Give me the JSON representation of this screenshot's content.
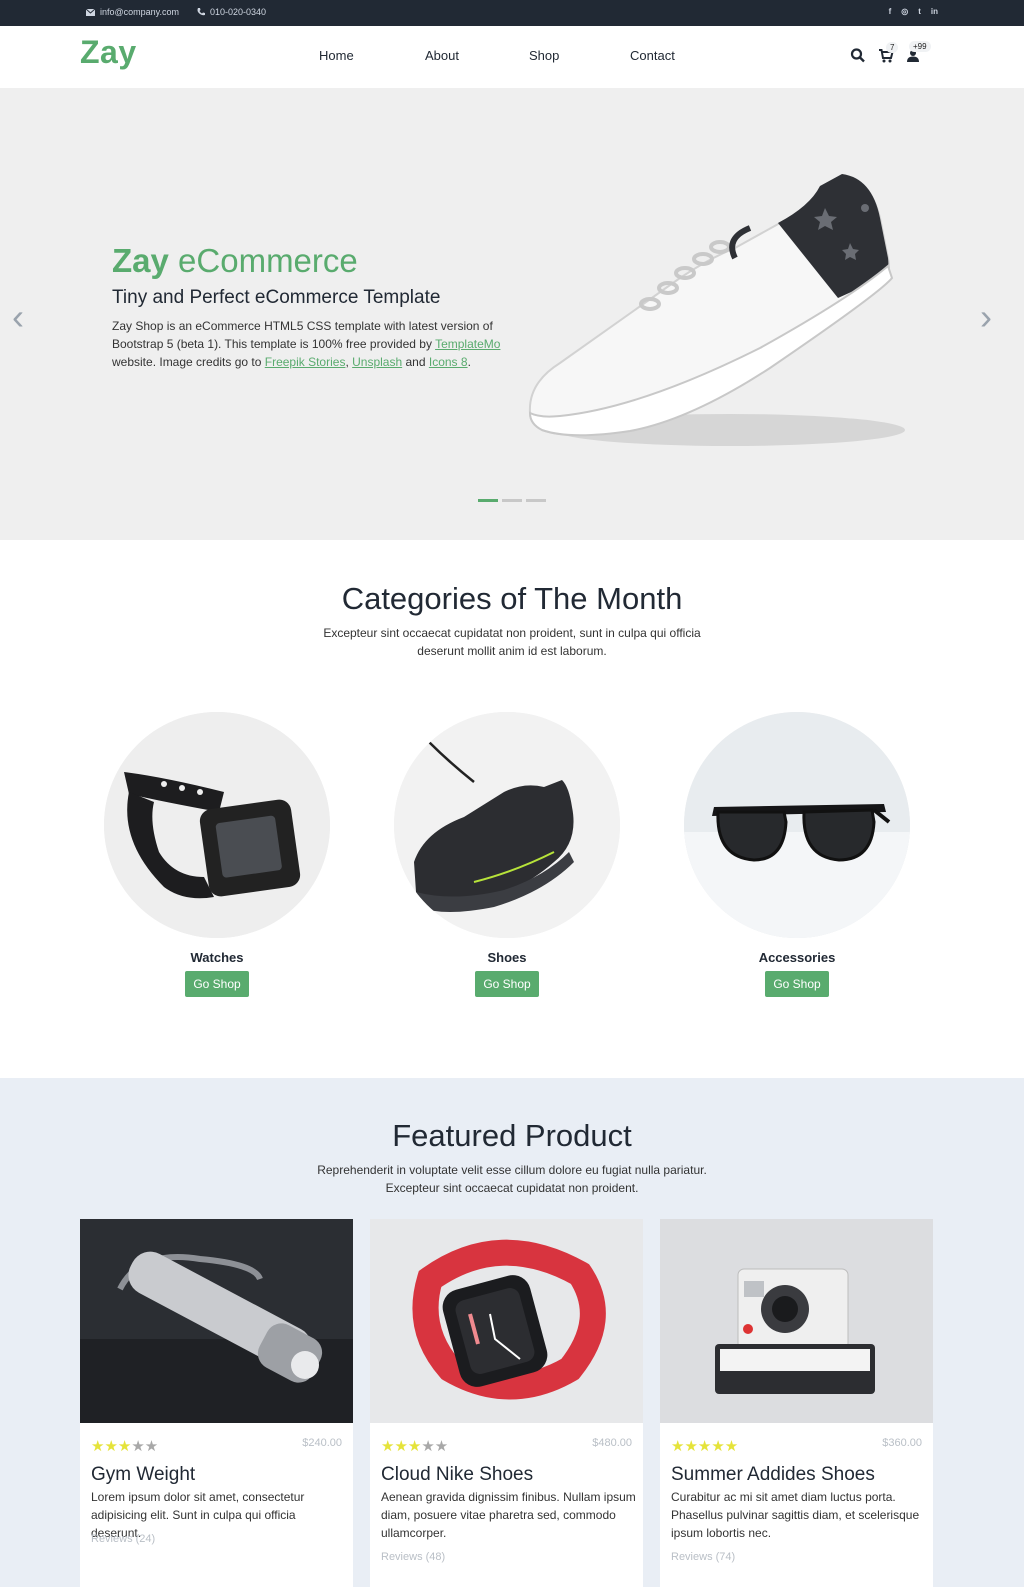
{
  "topbar": {
    "email": "info@company.com",
    "phone": "010-020-0340",
    "social": [
      "f",
      "◎",
      "t",
      "in"
    ]
  },
  "nav": {
    "logo": "Zay",
    "links": [
      "Home",
      "About",
      "Shop",
      "Contact"
    ],
    "cart_count": "7",
    "user_count": "+99"
  },
  "hero": {
    "title_strong": "Zay",
    "title_rest": " eCommerce",
    "subtitle": "Tiny and Perfect eCommerce Template",
    "desc_1": "Zay Shop is an eCommerce HTML5 CSS template with latest version of Bootstrap 5 (beta 1). This template is 100% free provided by ",
    "link_templatemo": "TemplateMo",
    "desc_2": " website. Image credits go to ",
    "link_freepik": "Freepik Stories",
    "desc_3": ", ",
    "link_unsplash": "Unsplash",
    "desc_4": " and ",
    "link_icons8": "Icons 8",
    "desc_5": ".",
    "prev_arrow": "‹",
    "next_arrow": "›",
    "active_slide": 1,
    "slide_count": 3
  },
  "categories": {
    "title": "Categories of The Month",
    "desc": "Excepteur sint occaecat cupidatat non proident, sunt in culpa qui officia deserunt mollit anim id est laborum.",
    "items": [
      {
        "name": "Watches",
        "button": "Go Shop"
      },
      {
        "name": "Shoes",
        "button": "Go Shop"
      },
      {
        "name": "Accessories",
        "button": "Go Shop"
      }
    ]
  },
  "featured": {
    "title": "Featured Product",
    "desc_1": "Reprehenderit in voluptate velit esse cillum dolore eu fugiat nulla pariatur.",
    "desc_2": "Excepteur sint occaecat cupidatat non proident.",
    "products": [
      {
        "stars": 3,
        "price": "$240.00",
        "title": "Gym Weight",
        "desc": "Lorem ipsum dolor sit amet, consectetur adipisicing elit. Sunt in culpa qui officia deserunt.",
        "reviews": "Reviews (24)"
      },
      {
        "stars": 3,
        "price": "$480.00",
        "title": "Cloud Nike Shoes",
        "desc": "Aenean gravida dignissim finibus. Nullam ipsum diam, posuere vitae pharetra sed, commodo ullamcorper.",
        "reviews": "Reviews (48)"
      },
      {
        "stars": 5,
        "price": "$360.00",
        "title": "Summer Addides Shoes",
        "desc": "Curabitur ac mi sit amet diam luctus porta. Phasellus pulvinar sagittis diam, et scelerisque ipsum lobortis nec.",
        "reviews": "Reviews (74)"
      }
    ]
  },
  "colors": {
    "brand": "#59ab6e",
    "dark": "#212934",
    "star": "#e5e33a"
  }
}
